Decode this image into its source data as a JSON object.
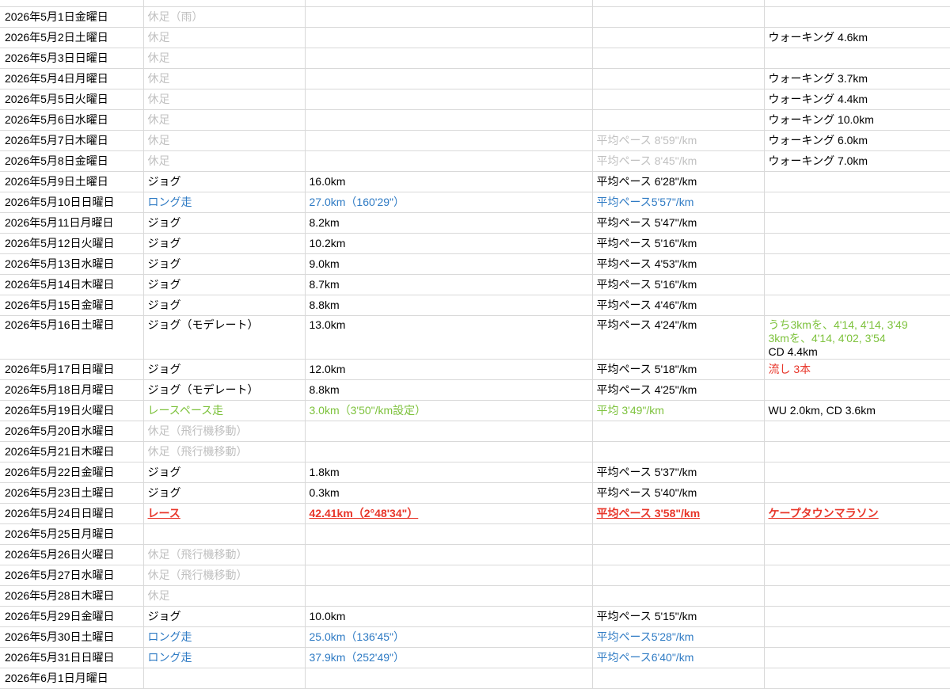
{
  "colors": {
    "rest": "#c0c0c0",
    "long_run": "#2f7bc4",
    "race_pace": "#7dc23c",
    "race": "#e8362a",
    "note_red": "#e8362a",
    "grid": "#d9d9d9"
  },
  "rows": [
    {
      "date": "",
      "activity": "",
      "distance": "",
      "pace": "",
      "notes": [],
      "style": "partial-top"
    },
    {
      "date": "2026年5月1日金曜日",
      "activity": "休足（雨）",
      "distance": "",
      "pace": "",
      "notes": [],
      "style": "rest"
    },
    {
      "date": "2026年5月2日土曜日",
      "activity": "休足",
      "distance": "",
      "pace": "",
      "notes": [
        {
          "text": "ウォーキング 4.6km",
          "style": ""
        }
      ],
      "style": "rest"
    },
    {
      "date": "2026年5月3日日曜日",
      "activity": "休足",
      "distance": "",
      "pace": "",
      "notes": [],
      "style": "rest"
    },
    {
      "date": "2026年5月4日月曜日",
      "activity": "休足",
      "distance": "",
      "pace": "",
      "notes": [
        {
          "text": "ウォーキング 3.7km",
          "style": ""
        }
      ],
      "style": "rest"
    },
    {
      "date": "2026年5月5日火曜日",
      "activity": "休足",
      "distance": "",
      "pace": "",
      "notes": [
        {
          "text": "ウォーキング 4.4km",
          "style": ""
        }
      ],
      "style": "rest"
    },
    {
      "date": "2026年5月6日水曜日",
      "activity": "休足",
      "distance": "",
      "pace": "",
      "notes": [
        {
          "text": "ウォーキング 10.0km",
          "style": ""
        }
      ],
      "style": "rest"
    },
    {
      "date": "2026年5月7日木曜日",
      "activity": "休足",
      "distance": "",
      "pace": "平均ペース 8'59\"/km",
      "notes": [
        {
          "text": "ウォーキング 6.0km",
          "style": ""
        }
      ],
      "style": "rest"
    },
    {
      "date": "2026年5月8日金曜日",
      "activity": "休足",
      "distance": "",
      "pace": "平均ペース 8'45\"/km",
      "notes": [
        {
          "text": "ウォーキング 7.0km",
          "style": ""
        }
      ],
      "style": "rest"
    },
    {
      "date": "2026年5月9日土曜日",
      "activity": "ジョグ",
      "distance": "16.0km",
      "pace": "平均ペース 6'28\"/km",
      "notes": [],
      "style": ""
    },
    {
      "date": "2026年5月10日日曜日",
      "activity": "ロング走",
      "distance": "27.0km（160'29\"）",
      "pace": "平均ペース5'57\"/km",
      "notes": [],
      "style": "blue"
    },
    {
      "date": "2026年5月11日月曜日",
      "activity": "ジョグ",
      "distance": "8.2km",
      "pace": "平均ペース 5'47\"/km",
      "notes": [],
      "style": ""
    },
    {
      "date": "2026年5月12日火曜日",
      "activity": "ジョグ",
      "distance": "10.2km",
      "pace": "平均ペース 5'16\"/km",
      "notes": [],
      "style": ""
    },
    {
      "date": "2026年5月13日水曜日",
      "activity": "ジョグ",
      "distance": "9.0km",
      "pace": "平均ペース 4'53\"/km",
      "notes": [],
      "style": ""
    },
    {
      "date": "2026年5月14日木曜日",
      "activity": "ジョグ",
      "distance": "8.7km",
      "pace": "平均ペース 5'16\"/km",
      "notes": [],
      "style": ""
    },
    {
      "date": "2026年5月15日金曜日",
      "activity": "ジョグ",
      "distance": "8.8km",
      "pace": "平均ペース 4'46\"/km",
      "notes": [],
      "style": ""
    },
    {
      "date": "2026年5月16日土曜日",
      "activity": "ジョグ（モデレート）",
      "distance": "13.0km",
      "pace": "平均ペース 4'24\"/km",
      "notes": [
        {
          "text": "うち3kmを、4'14, 4'14, 3'49",
          "style": "green"
        },
        {
          "text": "3kmを、4'14, 4'02, 3'54",
          "style": "green"
        },
        {
          "text": "CD 4.4km",
          "style": ""
        }
      ],
      "style": "tall"
    },
    {
      "date": "2026年5月17日日曜日",
      "activity": "ジョグ",
      "distance": "12.0km",
      "pace": "平均ペース 5'18\"/km",
      "notes": [
        {
          "text": "流し 3本",
          "style": "red"
        }
      ],
      "style": ""
    },
    {
      "date": "2026年5月18日月曜日",
      "activity": "ジョグ（モデレート）",
      "distance": "8.8km",
      "pace": "平均ペース 4'25\"/km",
      "notes": [],
      "style": ""
    },
    {
      "date": "2026年5月19日火曜日",
      "activity": "レースペース走",
      "distance": "3.0km（3'50\"/km設定）",
      "pace": "平均 3'49\"/km",
      "notes": [
        {
          "text": "WU 2.0km, CD 3.6km",
          "style": ""
        }
      ],
      "style": "green"
    },
    {
      "date": "2026年5月20日水曜日",
      "activity": "休足（飛行機移動）",
      "distance": "",
      "pace": "",
      "notes": [],
      "style": "rest"
    },
    {
      "date": "2026年5月21日木曜日",
      "activity": "休足（飛行機移動）",
      "distance": "",
      "pace": "",
      "notes": [],
      "style": "rest"
    },
    {
      "date": "2026年5月22日金曜日",
      "activity": "ジョグ",
      "distance": "1.8km",
      "pace": "平均ペース 5'37\"/km",
      "notes": [],
      "style": ""
    },
    {
      "date": "2026年5月23日土曜日",
      "activity": "ジョグ",
      "distance": "0.3km",
      "pace": "平均ペース 5'40\"/km",
      "notes": [],
      "style": ""
    },
    {
      "date": "2026年5月24日日曜日",
      "activity": "レース",
      "distance": "42.41km（2°48'34\"）",
      "pace": "平均ペース 3'58\"/km",
      "notes": [
        {
          "text": "ケープタウンマラソン",
          "style": "race"
        }
      ],
      "style": "race"
    },
    {
      "date": "2026年5月25日月曜日",
      "activity": "",
      "distance": "",
      "pace": "",
      "notes": [],
      "style": ""
    },
    {
      "date": "2026年5月26日火曜日",
      "activity": "休足（飛行機移動）",
      "distance": "",
      "pace": "",
      "notes": [],
      "style": "rest"
    },
    {
      "date": "2026年5月27日水曜日",
      "activity": "休足（飛行機移動）",
      "distance": "",
      "pace": "",
      "notes": [],
      "style": "rest"
    },
    {
      "date": "2026年5月28日木曜日",
      "activity": "休足",
      "distance": "",
      "pace": "",
      "notes": [],
      "style": "rest"
    },
    {
      "date": "2026年5月29日金曜日",
      "activity": "ジョグ",
      "distance": "10.0km",
      "pace": "平均ペース 5'15\"/km",
      "notes": [],
      "style": ""
    },
    {
      "date": "2026年5月30日土曜日",
      "activity": "ロング走",
      "distance": "25.0km（136'45\"）",
      "pace": "平均ペース5'28\"/km",
      "notes": [],
      "style": "blue"
    },
    {
      "date": "2026年5月31日日曜日",
      "activity": "ロング走",
      "distance": "37.9km（252'49\"）",
      "pace": "平均ペース6'40\"/km",
      "notes": [],
      "style": "blue"
    },
    {
      "date": "2026年6月1日月曜日",
      "activity": "",
      "distance": "",
      "pace": "",
      "notes": [],
      "style": ""
    }
  ]
}
